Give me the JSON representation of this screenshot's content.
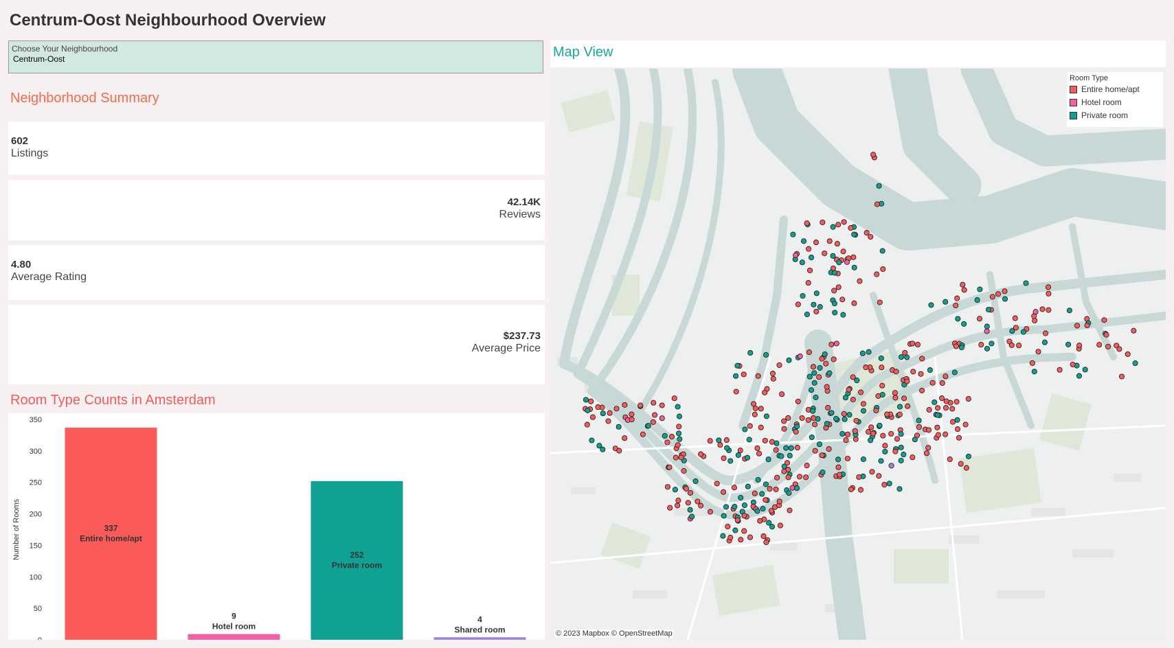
{
  "page": {
    "title": "Centrum-Oost Neighbourhood Overview"
  },
  "filter": {
    "label": "Choose Your Neighbourhood",
    "value": "Centrum-Oost"
  },
  "summary": {
    "title": "Neighborhood Summary",
    "listings": {
      "value": "602",
      "label": "Listings"
    },
    "reviews": {
      "value": "42.14K",
      "label": "Reviews"
    },
    "rating": {
      "value": "4.80",
      "label": "Average Rating"
    },
    "price": {
      "value": "$237.73",
      "label": "Average Price"
    }
  },
  "room_types": {
    "title": "Room Type Counts in Amsterdam"
  },
  "chart_data": {
    "type": "bar",
    "categories": [
      "Entire home/apt",
      "Hotel room",
      "Private room",
      "Shared room"
    ],
    "values": [
      337,
      9,
      252,
      4
    ],
    "colors": [
      "#fb5a5b",
      "#f45fa6",
      "#0fa293",
      "#9b86d6"
    ],
    "ylabel": "Number of Rooms",
    "xlabel": "",
    "ylim": [
      0,
      350
    ],
    "yticks": [
      0,
      50,
      100,
      150,
      200,
      250,
      300,
      350
    ],
    "bar_labels": true,
    "grid": false
  },
  "map": {
    "title": "Map View",
    "legend": {
      "title": "Room Type",
      "items": [
        {
          "label": "Entire home/apt",
          "color": "#fb5a5b"
        },
        {
          "label": "Hotel room",
          "color": "#f45fa6"
        },
        {
          "label": "Private room",
          "color": "#0fa293"
        }
      ]
    },
    "attribution": "© 2023 Mapbox © OpenStreetMap"
  }
}
